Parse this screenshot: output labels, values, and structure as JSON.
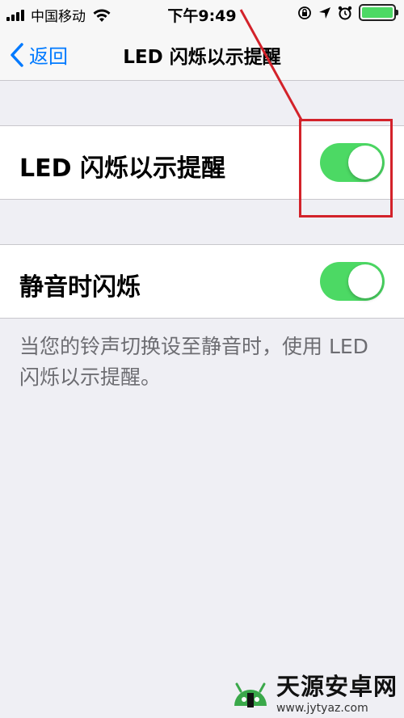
{
  "status_bar": {
    "carrier": "中国移动",
    "time": "下午9:49"
  },
  "nav": {
    "back_label": "返回",
    "title": "LED 闪烁以示提醒"
  },
  "settings": [
    {
      "label": "LED 闪烁以示提醒",
      "enabled": true
    },
    {
      "label": "静音时闪烁",
      "enabled": true
    }
  ],
  "footer_note": "当您的铃声切换设至静音时，使用 LED 闪烁以示提醒。",
  "colors": {
    "accent": "#007aff",
    "toggle_on": "#4cd964",
    "annotation": "#d3222a",
    "battery": "#4cd964"
  },
  "watermark": {
    "title": "天源安卓网",
    "url": "www.jytyaz.com"
  }
}
